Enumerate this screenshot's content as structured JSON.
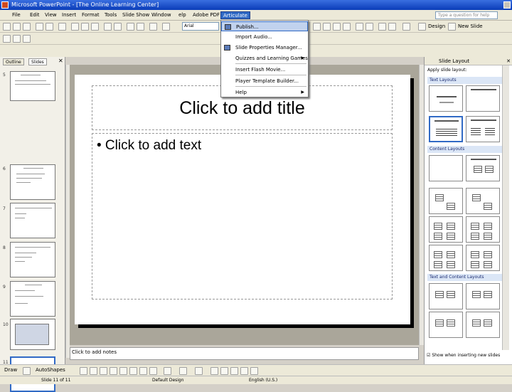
{
  "window": {
    "title": "Microsoft PowerPoint - [The Online Learning Center]"
  },
  "menus": [
    "File",
    "Edit",
    "View",
    "Insert",
    "Format",
    "Tools",
    "Slide Show",
    "Window",
    "elp",
    "Adobe PDF",
    "Articulate"
  ],
  "ask_placeholder": "Type a question for help",
  "font": {
    "name": "Arial"
  },
  "toolbar_labels": {
    "design": "Design",
    "new_slide": "New Slide"
  },
  "left_pane": {
    "tabs": [
      "Outline",
      "Slides"
    ],
    "slide_numbers": [
      "5",
      "6",
      "7",
      "8",
      "9",
      "10",
      "11"
    ]
  },
  "slide": {
    "title_placeholder": "Click to add title",
    "body_placeholder": "• Click to add text"
  },
  "notes_placeholder": "Click to add notes",
  "task_pane": {
    "title": "Slide Layout",
    "apply_label": "Apply slide layout:",
    "sections": [
      "Text Layouts",
      "Content Layouts",
      "Text and Content Layouts"
    ],
    "show_when_inserting": "Show when inserting new slides"
  },
  "articulate_menu": {
    "items": [
      "Publish...",
      "Import Audio...",
      "Slide Properties Manager...",
      "Quizzes and Learning Games",
      "Insert Flash Movie...",
      "Player Template Builder...",
      "Help"
    ]
  },
  "draw_toolbar": {
    "draw": "Draw",
    "autoshapes": "AutoShapes"
  },
  "status": {
    "slide": "Slide 11 of 11",
    "design": "Default Design",
    "language": "English (U.S.)"
  }
}
